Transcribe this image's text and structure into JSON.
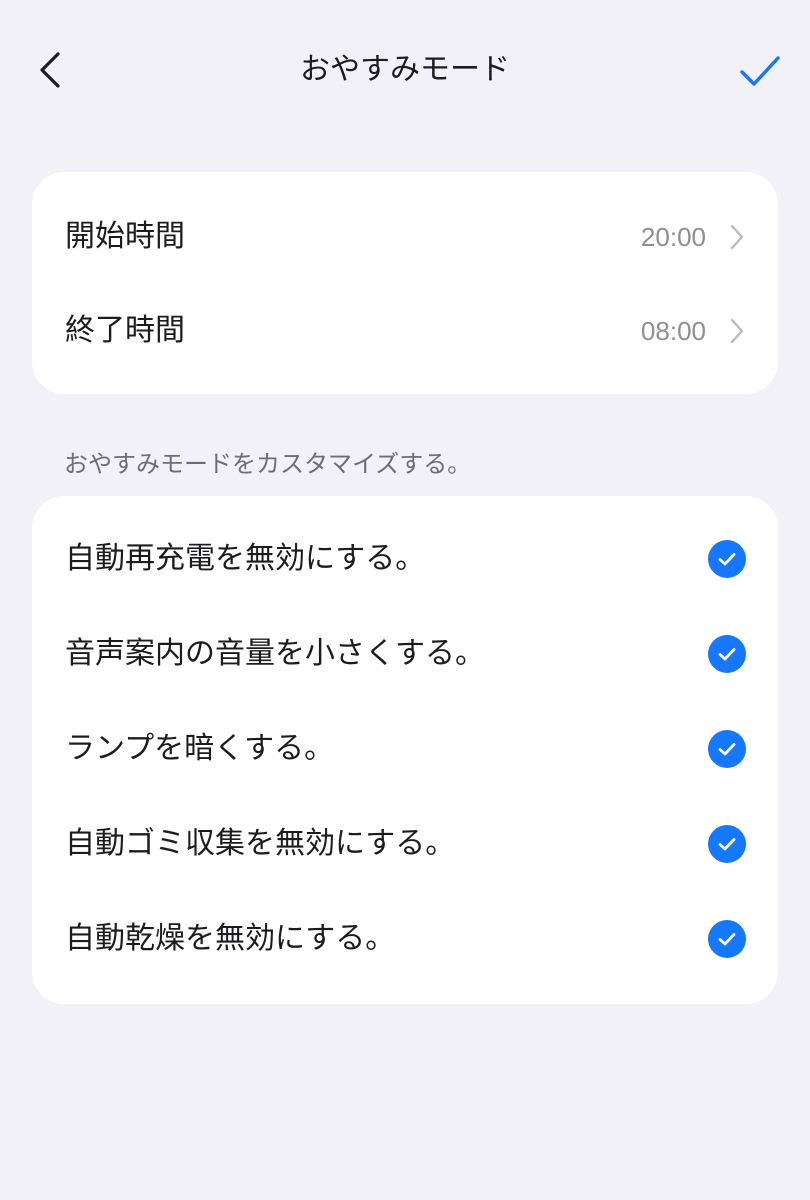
{
  "header": {
    "title": "おやすみモード",
    "back_icon": "chevron-left-icon",
    "confirm_icon": "checkmark-icon",
    "accent_color": "#1677ff"
  },
  "schedule": {
    "start": {
      "label": "開始時間",
      "value": "20:00"
    },
    "end": {
      "label": "終了時間",
      "value": "08:00"
    }
  },
  "customize": {
    "caption": "おやすみモードをカスタマイズする。",
    "options": [
      {
        "label": "自動再充電を無効にする。",
        "checked": true
      },
      {
        "label": "音声案内の音量を小さくする。",
        "checked": true
      },
      {
        "label": "ランプを暗くする。",
        "checked": true
      },
      {
        "label": "自動ゴミ収集を無効にする。",
        "checked": true
      },
      {
        "label": "自動乾燥を無効にする。",
        "checked": true
      }
    ]
  }
}
